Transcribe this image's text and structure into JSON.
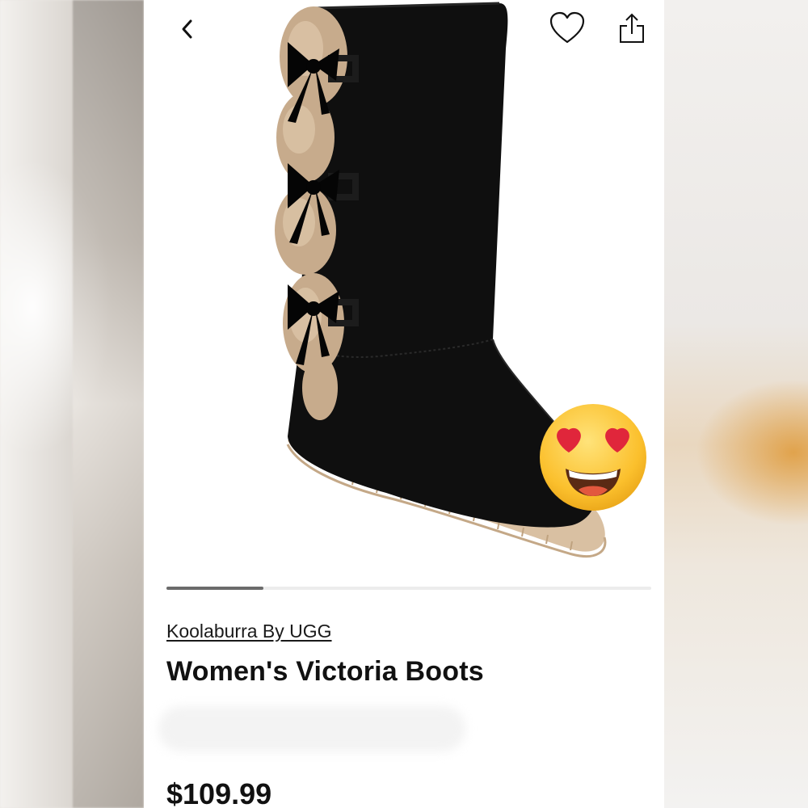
{
  "header": {
    "back_icon": "chevron-left-icon",
    "favorite_icon": "heart-outline-icon",
    "share_icon": "share-icon"
  },
  "gallery": {
    "image_subject": "black-suede-boot-with-fur-and-bows",
    "progress": 0.2
  },
  "reaction": {
    "emoji": "heart-eyes-emoji"
  },
  "product": {
    "brand": "Koolaburra By UGG",
    "title": "Women's Victoria Boots",
    "price": "$109.99"
  },
  "colors": {
    "page_bg": "#ffffff",
    "text": "#111111",
    "carousel_track": "#ececec",
    "carousel_active": "#6b6b6b"
  }
}
